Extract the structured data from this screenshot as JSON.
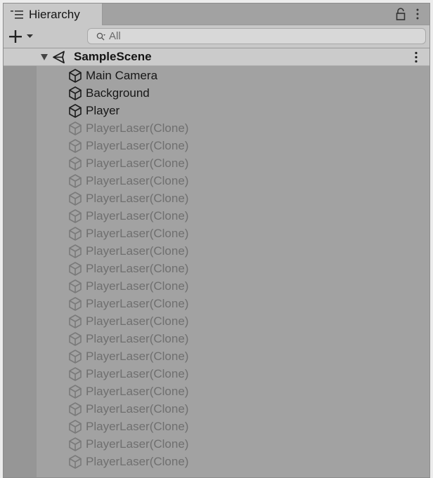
{
  "window": {
    "tab_label": "Hierarchy",
    "tab_icon": "list-icon",
    "lock_icon": "lock-icon",
    "menu_icon": "vertical-dots-icon"
  },
  "toolbar": {
    "add_icon": "plus-icon",
    "add_dropdown_icon": "triangle-down-icon",
    "search_placeholder": "All",
    "search_value": ""
  },
  "scene": {
    "name": "SampleScene",
    "expanded": true,
    "icon": "unity-icon"
  },
  "items": [
    {
      "label": "Main Camera",
      "active": true,
      "icon": "cube-icon"
    },
    {
      "label": "Background",
      "active": true,
      "icon": "cube-icon"
    },
    {
      "label": "Player",
      "active": true,
      "icon": "cube-icon"
    },
    {
      "label": "PlayerLaser(Clone)",
      "active": false,
      "icon": "cube-icon"
    },
    {
      "label": "PlayerLaser(Clone)",
      "active": false,
      "icon": "cube-icon"
    },
    {
      "label": "PlayerLaser(Clone)",
      "active": false,
      "icon": "cube-icon"
    },
    {
      "label": "PlayerLaser(Clone)",
      "active": false,
      "icon": "cube-icon"
    },
    {
      "label": "PlayerLaser(Clone)",
      "active": false,
      "icon": "cube-icon"
    },
    {
      "label": "PlayerLaser(Clone)",
      "active": false,
      "icon": "cube-icon"
    },
    {
      "label": "PlayerLaser(Clone)",
      "active": false,
      "icon": "cube-icon"
    },
    {
      "label": "PlayerLaser(Clone)",
      "active": false,
      "icon": "cube-icon"
    },
    {
      "label": "PlayerLaser(Clone)",
      "active": false,
      "icon": "cube-icon"
    },
    {
      "label": "PlayerLaser(Clone)",
      "active": false,
      "icon": "cube-icon"
    },
    {
      "label": "PlayerLaser(Clone)",
      "active": false,
      "icon": "cube-icon"
    },
    {
      "label": "PlayerLaser(Clone)",
      "active": false,
      "icon": "cube-icon"
    },
    {
      "label": "PlayerLaser(Clone)",
      "active": false,
      "icon": "cube-icon"
    },
    {
      "label": "PlayerLaser(Clone)",
      "active": false,
      "icon": "cube-icon"
    },
    {
      "label": "PlayerLaser(Clone)",
      "active": false,
      "icon": "cube-icon"
    },
    {
      "label": "PlayerLaser(Clone)",
      "active": false,
      "icon": "cube-icon"
    },
    {
      "label": "PlayerLaser(Clone)",
      "active": false,
      "icon": "cube-icon"
    },
    {
      "label": "PlayerLaser(Clone)",
      "active": false,
      "icon": "cube-icon"
    },
    {
      "label": "PlayerLaser(Clone)",
      "active": false,
      "icon": "cube-icon"
    },
    {
      "label": "PlayerLaser(Clone)",
      "active": false,
      "icon": "cube-icon"
    }
  ],
  "colors": {
    "panel_bg": "#a2a2a2",
    "header_bg": "#c8c8c8",
    "gutter_bg": "#969696",
    "active_text": "#161616",
    "inactive_text": "#6f6f6f"
  }
}
